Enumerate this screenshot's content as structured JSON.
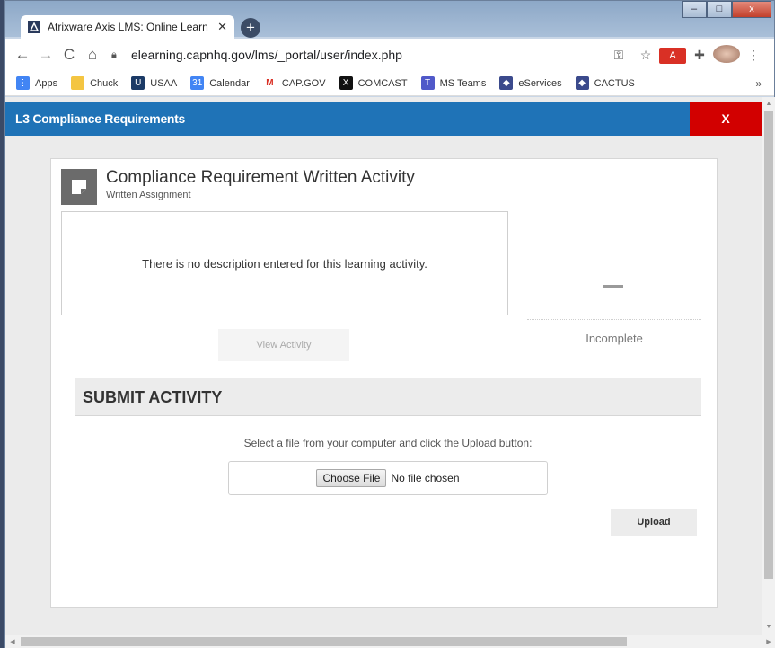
{
  "browser": {
    "tab_title": "Atrixware Axis LMS: Online Learn",
    "tab_close": "✕",
    "new_tab": "+",
    "url": "elearning.capnhq.gov/lms/_portal/user/index.php",
    "window_buttons": {
      "minimize": "–",
      "maximize": "□",
      "close": "x"
    },
    "nav": {
      "back": "←",
      "forward": "→",
      "reload": "C",
      "home": "⌂"
    },
    "bookmarks": [
      {
        "label": "Apps",
        "icon": "apps-icon",
        "color": "#4285f4"
      },
      {
        "label": "Chuck",
        "icon": "folder-icon",
        "color": "#f4c542"
      },
      {
        "label": "USAA",
        "icon": "usaa-icon",
        "color": "#1b3a66"
      },
      {
        "label": "Calendar",
        "icon": "calendar-icon",
        "color": "#4285f4"
      },
      {
        "label": "CAP.GOV",
        "icon": "gmail-icon",
        "color": "#d93025"
      },
      {
        "label": "COMCAST",
        "icon": "comcast-icon",
        "color": "#111111"
      },
      {
        "label": "MS Teams",
        "icon": "teams-icon",
        "color": "#5059c9"
      },
      {
        "label": "eServices",
        "icon": "cap-icon",
        "color": "#3b4a8c"
      },
      {
        "label": "CACTUS",
        "icon": "cap-icon",
        "color": "#3b4a8c"
      }
    ],
    "bookmarks_more": "»"
  },
  "modal": {
    "title": "L3 Compliance Requirements",
    "close_label": "X"
  },
  "activity": {
    "title": "Compliance Requirement Written Activity",
    "subtitle": "Written Assignment",
    "description": "There is no description entered for this learning activity.",
    "status_dash": "—",
    "status": "Incomplete",
    "view_button": "View Activity"
  },
  "submit": {
    "heading": "SUBMIT ACTIVITY",
    "instructions": "Select a file from your computer and click the Upload button:",
    "choose_file": "Choose File",
    "no_file": "No file chosen",
    "upload_button": "Upload"
  },
  "colors": {
    "modal_bar": "#1f73b7",
    "modal_close": "#d20000"
  }
}
